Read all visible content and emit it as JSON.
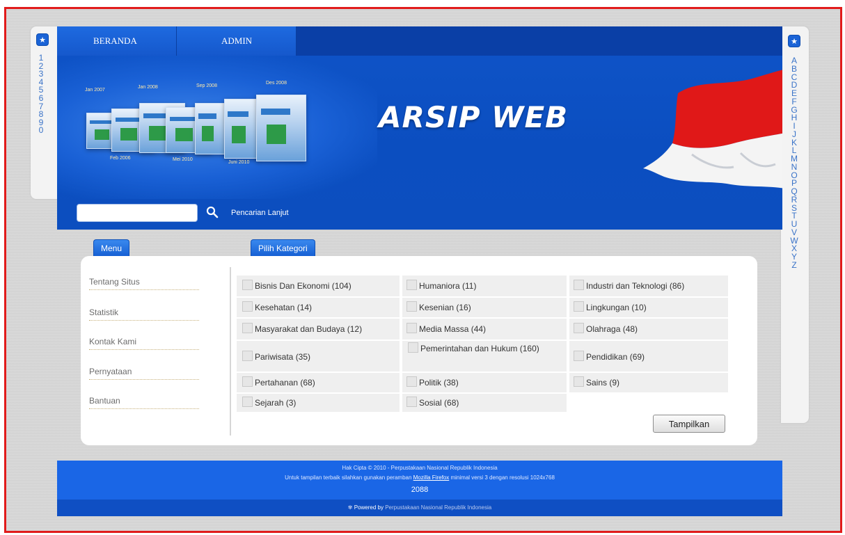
{
  "nav": {
    "home": "BERANDA",
    "admin": "ADMIN"
  },
  "banner": {
    "logo_text": "ARSIP WEB",
    "thumb_labels": [
      "Jan 2007",
      "Jan 2008",
      "Sep 2008",
      "Des 2008",
      "Feb 2006",
      "Mei 2010",
      "Juni 2010"
    ]
  },
  "search": {
    "placeholder": "",
    "value": "",
    "advanced_link": "Pencarian Lanjut"
  },
  "index_numbers": [
    "1",
    "2",
    "3",
    "4",
    "5",
    "6",
    "7",
    "8",
    "9",
    "0"
  ],
  "index_letters": [
    "A",
    "B",
    "C",
    "D",
    "E",
    "F",
    "G",
    "H",
    "I",
    "J",
    "K",
    "L",
    "M",
    "N",
    "O",
    "P",
    "Q",
    "R",
    "S",
    "T",
    "U",
    "V",
    "W",
    "X",
    "Y",
    "Z"
  ],
  "menu": {
    "tab_label": "Menu",
    "items": [
      "Tentang Situs",
      "Statistik",
      "Kontak Kami",
      "Pernyataan",
      "Bantuan"
    ]
  },
  "categories": {
    "tab_label": "Pilih Kategori",
    "items": [
      {
        "label": "Bisnis Dan Ekonomi (104)"
      },
      {
        "label": "Humaniora (11)"
      },
      {
        "label": "Industri dan Teknologi (86)"
      },
      {
        "label": "Kesehatan (14)"
      },
      {
        "label": "Kesenian (16)"
      },
      {
        "label": "Lingkungan (10)"
      },
      {
        "label": "Masyarakat dan Budaya (12)"
      },
      {
        "label": "Media Massa (44)"
      },
      {
        "label": "Olahraga (48)"
      },
      {
        "label": "Pariwisata (35)"
      },
      {
        "label": "Pemerintahan dan Hukum (160)"
      },
      {
        "label": "Pendidikan (69)"
      },
      {
        "label": "Pertahanan (68)"
      },
      {
        "label": "Politik (38)"
      },
      {
        "label": "Sains (9)"
      },
      {
        "label": "Sejarah (3)"
      },
      {
        "label": "Sosial (68)"
      }
    ],
    "submit_label": "Tampilkan"
  },
  "footer": {
    "copyright": "Hak Cipta © 2010 - Perpustakaan Nasional Republik Indonesia",
    "browser_note_before": "Untuk tampilan terbaik silahkan gunakan peramban",
    "browser_link": "Mozilla Firefox",
    "browser_note_after": "minimal versi 3 dengan resolusi 1024x768",
    "counter": "2088",
    "powered_prefix": "Powered by",
    "powered_by": "Perpustakaan Nasional Republik Indonesia"
  },
  "colors": {
    "header_blue": "#0f54c8",
    "footer_blue": "#1a66e6",
    "frame_red": "#e11b1b",
    "link_blue": "#3a73c8"
  }
}
